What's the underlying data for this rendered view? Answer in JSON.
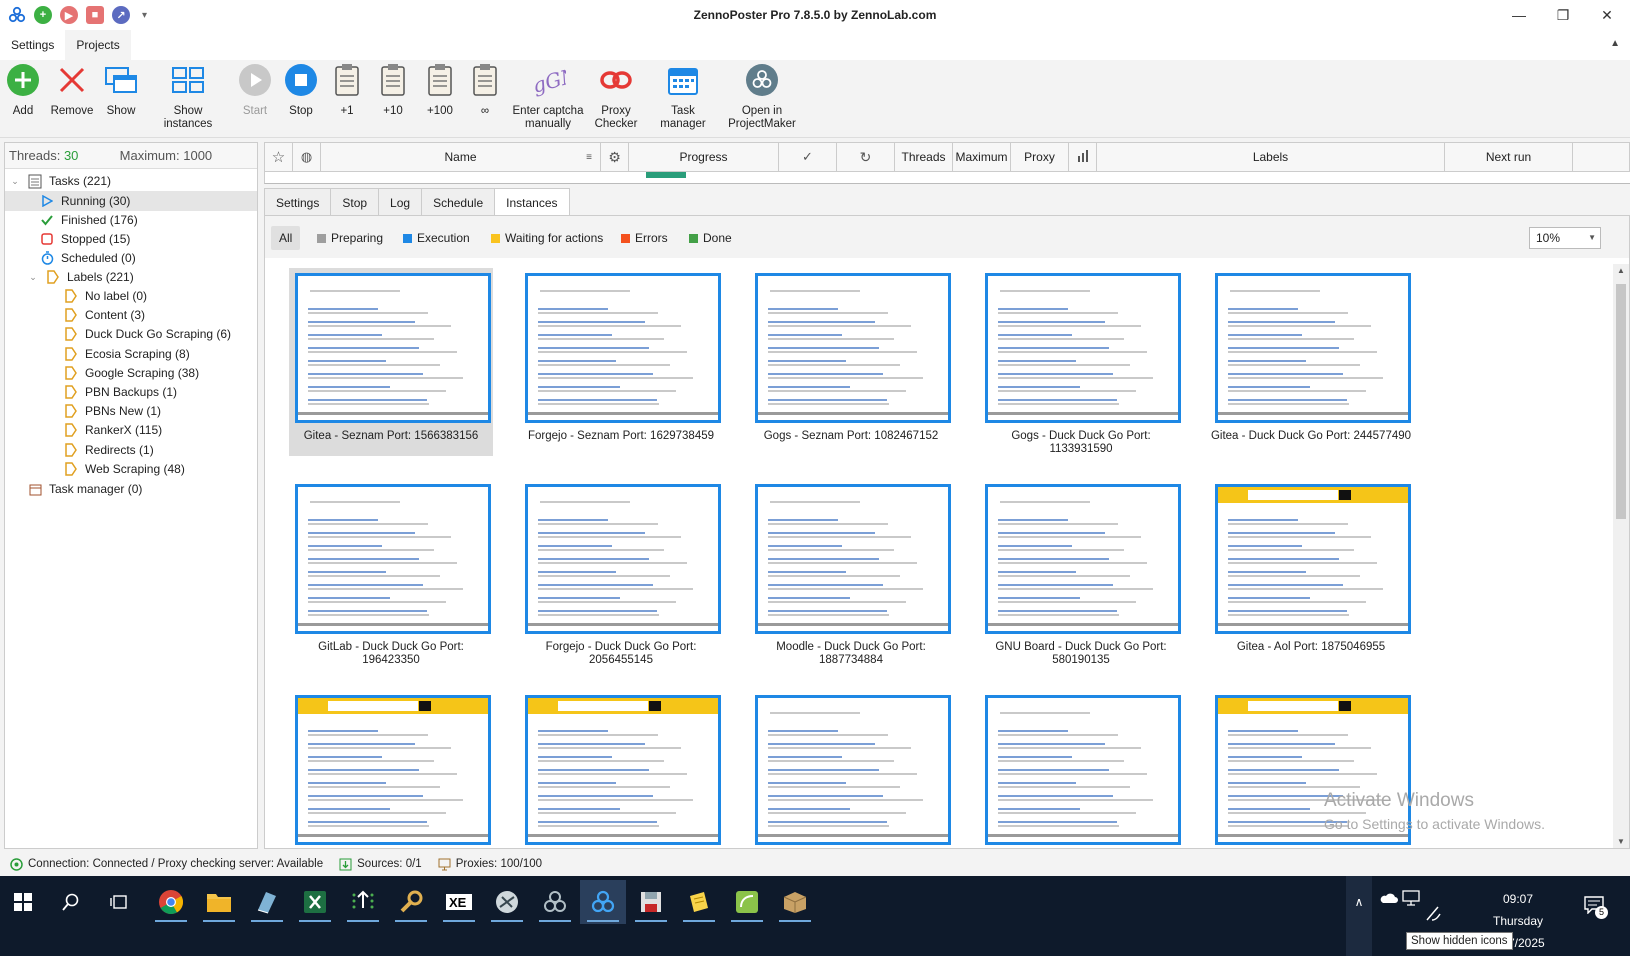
{
  "window": {
    "title": "ZennoPoster Pro 7.8.5.0 by ZennoLab.com"
  },
  "menu": {
    "tabs": [
      "Settings",
      "Projects"
    ]
  },
  "ribbon": {
    "add": "Add",
    "remove": "Remove",
    "show": "Show",
    "show_instances": "Show instances",
    "start": "Start",
    "stop": "Stop",
    "plus1": "+1",
    "plus10": "+10",
    "plus100": "+100",
    "infinity": "∞",
    "enter_captcha_1": "Enter captcha",
    "enter_captcha_2": "manually",
    "proxy_checker_1": "Proxy",
    "proxy_checker_2": "Checker",
    "task_manager": "Task manager",
    "open_pm_1": "Open in",
    "open_pm_2": "ProjectMaker"
  },
  "threads": {
    "label": "Threads:",
    "value": "30",
    "max_label": "Maximum:",
    "max_value": "1000"
  },
  "tree": {
    "tasks": "Tasks (221)",
    "running": "Running (30)",
    "finished": "Finished (176)",
    "stopped": "Stopped (15)",
    "scheduled": "Scheduled (0)",
    "labels": "Labels (221)",
    "label_items": [
      "No label (0)",
      "Content (3)",
      "Duck Duck Go Scraping (6)",
      "Ecosia Scraping (8)",
      "Google Scraping (38)",
      "PBN Backups (1)",
      "PBNs New (1)",
      "RankerX (115)",
      "Redirects (1)",
      "Web Scraping (48)"
    ],
    "task_manager": "Task manager (0)"
  },
  "grid": {
    "columns": [
      "Name",
      "Progress",
      "Threads",
      "Maximum",
      "Proxy",
      "Labels",
      "Next run"
    ]
  },
  "subtabs": [
    "Settings",
    "Stop",
    "Log",
    "Schedule",
    "Instances"
  ],
  "filters": {
    "all": "All",
    "items": [
      {
        "label": "Preparing",
        "color": "#9e9e9e"
      },
      {
        "label": "Execution",
        "color": "#1e88e5"
      },
      {
        "label": "Waiting for actions",
        "color": "#f9c31f"
      },
      {
        "label": "Errors",
        "color": "#f4511e"
      },
      {
        "label": "Done",
        "color": "#43a047"
      }
    ],
    "zoom": "10%"
  },
  "instances": [
    "Gitea - Seznam Port: 1566383156",
    "Forgejo - Seznam Port: 1629738459",
    "Gogs - Seznam Port: 1082467152",
    "Gogs - Duck Duck Go Port: 1133931590",
    "Gitea - Duck Duck Go Port: 244577490",
    "GitLab - Duck Duck Go Port: 196423350",
    "Forgejo - Duck Duck Go Port: 2056455145",
    "Moodle - Duck Duck Go Port: 1887734884",
    "GNU Board - Duck Duck Go Port: 580190135",
    "Gitea - Aol Port: 1875046955"
  ],
  "statusbar": {
    "connection": "Connection: Connected / Proxy checking server: Available",
    "sources": "Sources: 0/1",
    "proxies": "Proxies: 100/100"
  },
  "watermark": {
    "line1": "Activate Windows",
    "line2": "Go to Settings to activate Windows."
  },
  "taskbar": {
    "time": "09:07",
    "day": "Thursday",
    "date": "3/07/2025",
    "tooltip": "Show hidden icons",
    "notif_count": "5"
  },
  "colors": {
    "accent": "#1e88e5",
    "green": "#2a9d3a"
  }
}
